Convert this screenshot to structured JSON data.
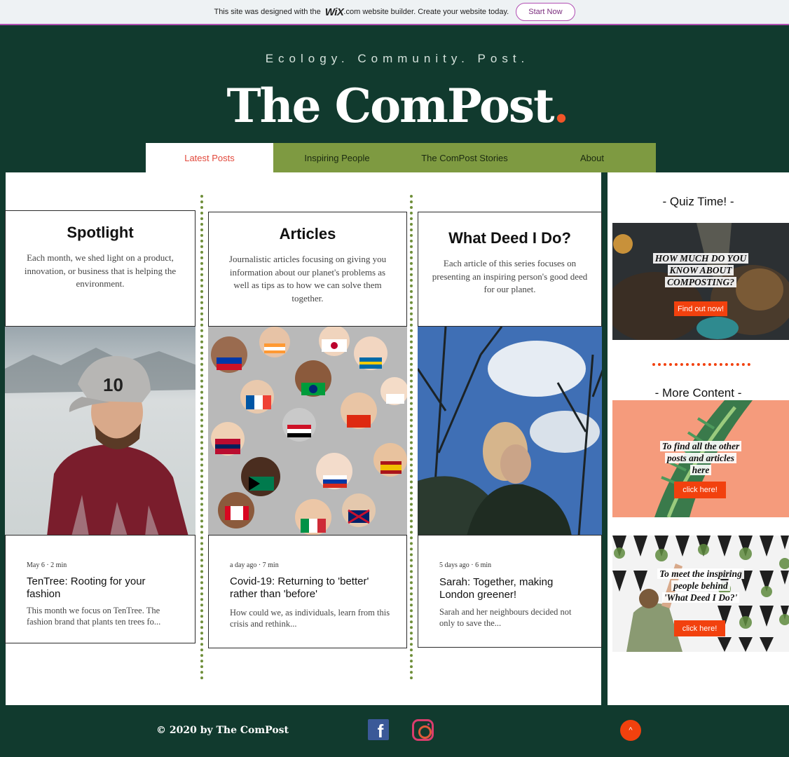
{
  "wix_banner": {
    "text_before": "This site was designed with the",
    "logo": "WiX",
    "text_after": ".com website builder. Create your website today.",
    "start_now": "Start Now"
  },
  "header": {
    "tagline": "Ecology. Community. Post.",
    "title": "The ComPost",
    "title_dot": "."
  },
  "nav": {
    "items": [
      {
        "label": "Latest Posts",
        "active": true
      },
      {
        "label": "Inspiring People"
      },
      {
        "label": "The ComPost Stories"
      },
      {
        "label": "About"
      }
    ]
  },
  "cards": [
    {
      "title": "Spotlight",
      "description": "Each month, we shed light on a product, innovation, or business that is helping the environment.",
      "post": {
        "meta": "May 6  ·  2 min",
        "title": "TenTree: Rooting for your fashion",
        "excerpt": "This month we focus on TenTree. The fashion brand that plants ten trees fo..."
      }
    },
    {
      "title": "Articles",
      "description": "Journalistic articles focusing on giving you information about our planet's problems as well as tips as to how we can solve them together.",
      "post": {
        "meta": "a day ago  ·  7 min",
        "title": "Covid-19: Returning to 'better' rather than 'before'",
        "excerpt": "How could we, as individuals, learn from this crisis and rethink..."
      }
    },
    {
      "title": "What Deed I Do?",
      "description": "Each article of this series focuses on presenting an inspiring person's good deed for our planet.",
      "post": {
        "meta": "5 days ago  ·  6 min",
        "title": "Sarah: Together, making London greener!",
        "excerpt": "Sarah and her neighbours decided not only to save the..."
      }
    }
  ],
  "sidebar": {
    "quiz_title": "- Quiz Time! -",
    "quiz_text": [
      "HOW MUCH DO YOU",
      "KNOW ABOUT",
      "COMPOSTING?"
    ],
    "quiz_button": "Find out now!",
    "more_title": "- More Content -",
    "promo1_text": [
      "To find all the other",
      "posts and articles",
      "here"
    ],
    "promo1_button": "click here!",
    "promo2_text": [
      "To meet the inspiring",
      "people behind",
      "'What Deed I Do?'"
    ],
    "promo2_button": "click here!"
  },
  "footer": {
    "copyright": "© 2020 by The ComPost",
    "facebook_glyph": "f",
    "back_to_top": "^"
  },
  "colors": {
    "brand_green": "#113a2e",
    "nav_green": "#7e9a41",
    "accent_orange": "#f2410e",
    "active_nav_text": "#e2483b"
  }
}
